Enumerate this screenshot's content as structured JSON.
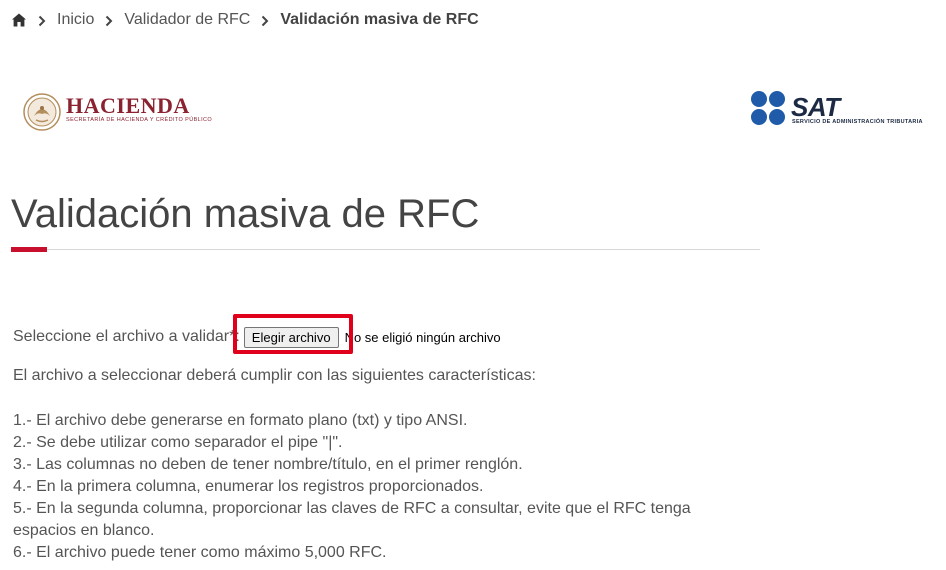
{
  "breadcrumb": {
    "items": [
      "Inicio",
      "Validador de RFC",
      "Validación masiva de RFC"
    ]
  },
  "logos": {
    "hacienda": {
      "name": "HACIENDA",
      "subtitle": "SECRETARÍA DE HACIENDA Y CRÉDITO PÚBLICO",
      "color": "#8b2230"
    },
    "sat": {
      "name": "SAT",
      "subtitle": "SERVICIO DE ADMINISTRACIÓN TRIBUTARIA",
      "color": "#1d2a44",
      "dot_color": "#1f5ba8"
    }
  },
  "page": {
    "title": "Validación masiva de RFC",
    "accent_color": "#c8102e"
  },
  "file_select": {
    "label": "Seleccione el archivo a validar*:",
    "button_label": "Elegir archivo",
    "status": "No se eligió ningún archivo",
    "highlight_color": "#e0001b"
  },
  "instructions": {
    "intro": "El archivo a seleccionar deberá cumplir con las siguientes características:",
    "rules": [
      "1.- El archivo debe generarse en formato plano (txt) y tipo ANSI.",
      "2.- Se debe utilizar como separador el pipe \"|\".",
      "3.- Las columnas no deben de tener nombre/título, en el primer renglón.",
      "4.- En la primera columna, enumerar los registros proporcionados.",
      "5.- En la segunda columna, proporcionar las claves de RFC a consultar, evite que el RFC tenga espacios en blanco.",
      "6.- El archivo puede tener como máximo 5,000 RFC."
    ]
  }
}
